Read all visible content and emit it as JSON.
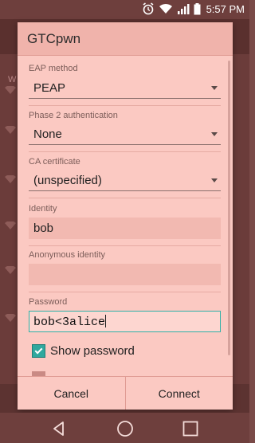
{
  "status_bar": {
    "time": "5:57 PM",
    "icons": [
      "alarm-icon",
      "wifi-icon",
      "signal-icon",
      "battery-icon"
    ]
  },
  "background": {
    "list_header_fragment": "W"
  },
  "dialog": {
    "title": "GTCpwn",
    "eap_method": {
      "label": "EAP method",
      "value": "PEAP"
    },
    "phase2": {
      "label": "Phase 2 authentication",
      "value": "None"
    },
    "ca_certificate": {
      "label": "CA certificate",
      "value": "(unspecified)"
    },
    "identity": {
      "label": "Identity",
      "value": "bob"
    },
    "anonymous_identity": {
      "label": "Anonymous identity",
      "value": ""
    },
    "password": {
      "label": "Password",
      "value": "bob<3alice"
    },
    "show_password": {
      "label": "Show password",
      "checked": true
    },
    "buttons": {
      "cancel": "Cancel",
      "connect": "Connect"
    }
  },
  "nav": {
    "icons": [
      "back-icon",
      "home-icon",
      "recents-icon"
    ]
  },
  "colors": {
    "dialog_bg": "#fbc9c2",
    "accent": "#2fb1a7",
    "status_bar": "#6e3f3d"
  }
}
